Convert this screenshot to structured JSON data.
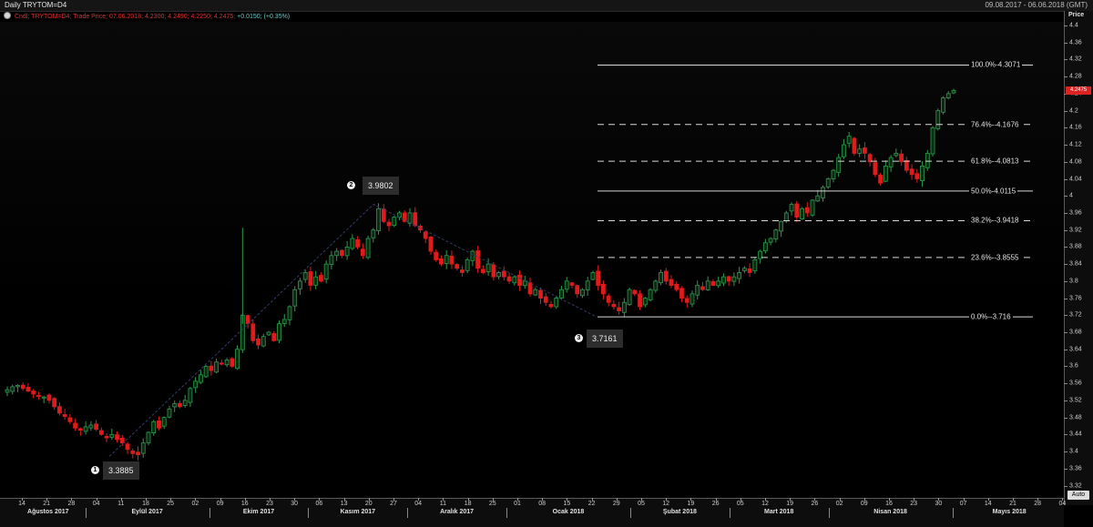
{
  "header": {
    "title": "Daily TRYTOM=D4",
    "range": "09.08.2017 - 06.06.2018 (GMT)"
  },
  "legend": {
    "label": "Cndl; TRYTOM=D4; Trade Price; 07.06.2018; 4.2300; 4.2490; 4.2250; 4.2475;",
    "change": "+0.0150; (+0.35%)"
  },
  "axis": {
    "price_label": "Price",
    "auto_label": "Auto",
    "last_price_label": "4.2475"
  },
  "colors": {
    "up": "#2e9a4e",
    "down": "#e01b1b",
    "background": "#000000",
    "fib": "#d8d8d8"
  },
  "chart_data": {
    "type": "candlestick",
    "ylabel": "Price",
    "ylim": [
      3.3,
      4.4
    ],
    "yticks": [
      "4.4",
      "4.36",
      "4.32",
      "4.28",
      "4.24",
      "4.2",
      "4.16",
      "4.12",
      "4.08",
      "4.04",
      "4",
      "3.96",
      "3.92",
      "3.88",
      "3.84",
      "3.8",
      "3.76",
      "3.72",
      "3.68",
      "3.64",
      "3.6",
      "3.56",
      "3.52",
      "3.48",
      "3.44",
      "3.4",
      "3.36",
      "3.32"
    ],
    "x_day_labels": [
      "14",
      "21",
      "28",
      "04",
      "11",
      "18",
      "25",
      "02",
      "09",
      "16",
      "23",
      "30",
      "06",
      "13",
      "20",
      "27",
      "04",
      "11",
      "18",
      "25",
      "01",
      "08",
      "15",
      "22",
      "29",
      "05",
      "12",
      "19",
      "26",
      "05",
      "12",
      "19",
      "26",
      "02",
      "09",
      "16",
      "23",
      "30",
      "07",
      "14",
      "21",
      "28",
      "04"
    ],
    "months": [
      "Ağustos 2017",
      "Eylül 2017",
      "Ekim 2017",
      "Kasım 2017",
      "Aralık 2017",
      "Ocak 2018",
      "Şubat 2018",
      "Mart 2018",
      "Nisan 2018",
      "Mayıs 2018"
    ],
    "anchors": [
      {
        "n": "1",
        "value": "3.3885"
      },
      {
        "n": "2",
        "value": "3.9802"
      },
      {
        "n": "3",
        "value": "3.7161"
      }
    ],
    "fibonacci": [
      {
        "label": "100.0%-4.3071",
        "price": 4.3071,
        "dashed": false
      },
      {
        "label": "76.4%--4.1676",
        "price": 4.1676,
        "dashed": true
      },
      {
        "label": "61.8%--4.0813",
        "price": 4.0813,
        "dashed": true
      },
      {
        "label": "50.0%-4.0115",
        "price": 4.0115,
        "dashed": false
      },
      {
        "label": "38.2%--3.9418",
        "price": 3.9418,
        "dashed": true
      },
      {
        "label": "23.6%--3.8555",
        "price": 3.8555,
        "dashed": true
      },
      {
        "label": "0.0%--3.716",
        "price": 3.716,
        "dashed": false
      }
    ],
    "close_path": [
      3.545,
      3.552,
      3.555,
      3.548,
      3.542,
      3.535,
      3.53,
      3.528,
      3.52,
      3.505,
      3.49,
      3.482,
      3.47,
      3.455,
      3.45,
      3.458,
      3.462,
      3.452,
      3.44,
      3.432,
      3.44,
      3.428,
      3.42,
      3.405,
      3.395,
      3.392,
      3.42,
      3.445,
      3.47,
      3.455,
      3.48,
      3.5,
      3.512,
      3.505,
      3.52,
      3.548,
      3.565,
      3.58,
      3.6,
      3.59,
      3.61,
      3.605,
      3.615,
      3.6,
      3.64,
      3.72,
      3.7,
      3.66,
      3.65,
      3.67,
      3.68,
      3.66,
      3.7,
      3.71,
      3.74,
      3.78,
      3.8,
      3.82,
      3.79,
      3.81,
      3.8,
      3.84,
      3.86,
      3.87,
      3.86,
      3.88,
      3.9,
      3.88,
      3.86,
      3.9,
      3.92,
      3.97,
      3.94,
      3.93,
      3.95,
      3.96,
      3.94,
      3.96,
      3.93,
      3.92,
      3.9,
      3.87,
      3.85,
      3.84,
      3.86,
      3.84,
      3.83,
      3.82,
      3.85,
      3.87,
      3.83,
      3.82,
      3.84,
      3.81,
      3.82,
      3.81,
      3.8,
      3.81,
      3.79,
      3.8,
      3.77,
      3.78,
      3.76,
      3.75,
      3.74,
      3.76,
      3.78,
      3.8,
      3.79,
      3.77,
      3.78,
      3.8,
      3.82,
      3.79,
      3.77,
      3.75,
      3.74,
      3.73,
      3.75,
      3.78,
      3.77,
      3.74,
      3.76,
      3.78,
      3.8,
      3.82,
      3.8,
      3.79,
      3.78,
      3.76,
      3.75,
      3.77,
      3.79,
      3.78,
      3.8,
      3.79,
      3.8,
      3.81,
      3.8,
      3.81,
      3.82,
      3.83,
      3.82,
      3.85,
      3.87,
      3.89,
      3.9,
      3.92,
      3.94,
      3.96,
      3.98,
      3.95,
      3.97,
      3.96,
      3.99,
      4.0,
      4.02,
      4.04,
      4.06,
      4.09,
      4.12,
      4.14,
      4.1,
      4.11,
      4.1,
      4.08,
      4.05,
      4.03,
      4.07,
      4.09,
      4.1,
      4.08,
      4.06,
      4.05,
      4.04,
      4.07,
      4.1,
      4.16,
      4.2,
      4.23,
      4.24,
      4.2475
    ]
  }
}
